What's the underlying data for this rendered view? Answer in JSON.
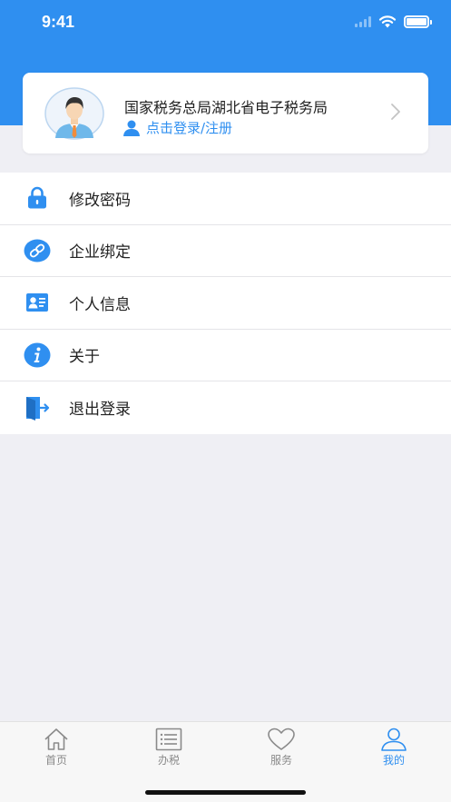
{
  "status_bar": {
    "time": "9:41"
  },
  "profile": {
    "title": "国家税务总局湖北省电子税务局",
    "login_text": "点击登录/注册"
  },
  "menu": {
    "items": [
      {
        "label": "修改密码",
        "icon": "lock-icon"
      },
      {
        "label": "企业绑定",
        "icon": "link-icon"
      },
      {
        "label": "个人信息",
        "icon": "id-card-icon"
      },
      {
        "label": "关于",
        "icon": "info-icon"
      },
      {
        "label": "退出登录",
        "icon": "logout-door-icon"
      }
    ]
  },
  "tab_bar": {
    "tabs": [
      {
        "label": "首页",
        "icon": "home-icon",
        "active": false
      },
      {
        "label": "办税",
        "icon": "list-icon",
        "active": false
      },
      {
        "label": "服务",
        "icon": "heart-icon",
        "active": false
      },
      {
        "label": "我的",
        "icon": "user-icon",
        "active": true
      }
    ]
  },
  "colors": {
    "accent": "#2f8ff0",
    "background": "#efeff4",
    "card": "#ffffff"
  }
}
